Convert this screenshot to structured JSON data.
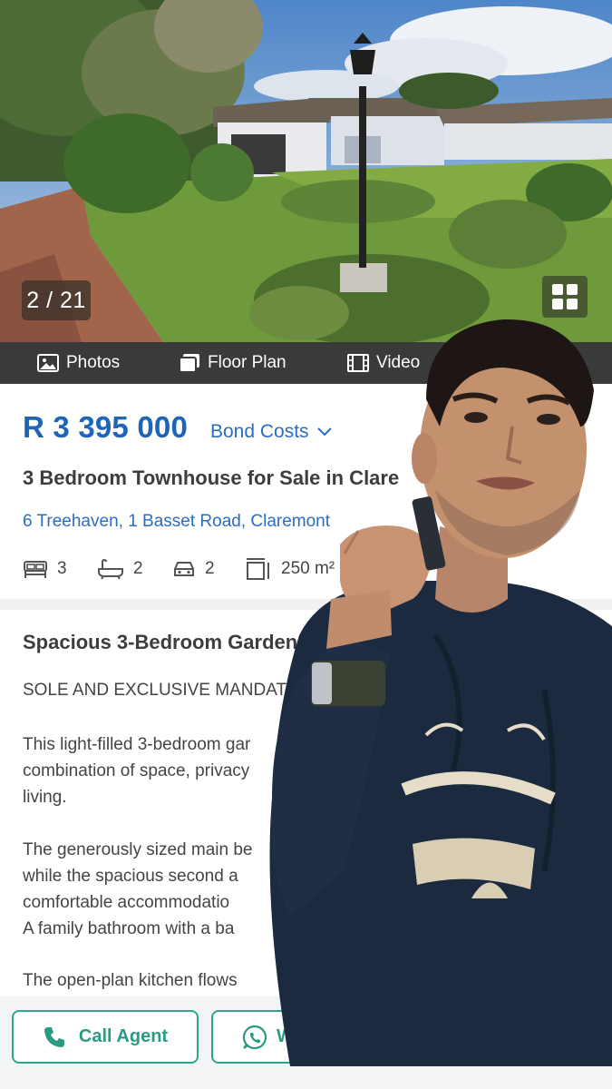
{
  "gallery": {
    "counter": "2 / 21"
  },
  "media_tabs": {
    "photos": "Photos",
    "floor_plan": "Floor Plan",
    "video": "Video"
  },
  "listing": {
    "price": "R 3 395 000",
    "bond_costs": "Bond Costs",
    "title": "3 Bedroom Townhouse for Sale in Clare",
    "address": "6 Treehaven, 1 Basset Road, Claremont",
    "features": {
      "bedrooms": "3",
      "bathrooms": "2",
      "parking": "2",
      "floor_size": "250 m²"
    }
  },
  "description": {
    "heading": "Spacious 3-Bedroom Garden",
    "mandate": "SOLE AND EXCLUSIVE MANDATE",
    "p1": "This light-filled 3-bedroom gar\ncombination of space, privacy\nliving.",
    "p2": "The generously sized main be\nwhile the spacious second a\ncomfortable accommodatio\nA family bathroom with a ba",
    "p3": "The open-plan kitchen flows"
  },
  "actions": {
    "call_agent": "Call Agent",
    "whatsapp": "W"
  },
  "colors": {
    "brand_blue": "#1e65b8",
    "action_green": "#2fa58c",
    "media_bar": "#3a3a3a"
  }
}
